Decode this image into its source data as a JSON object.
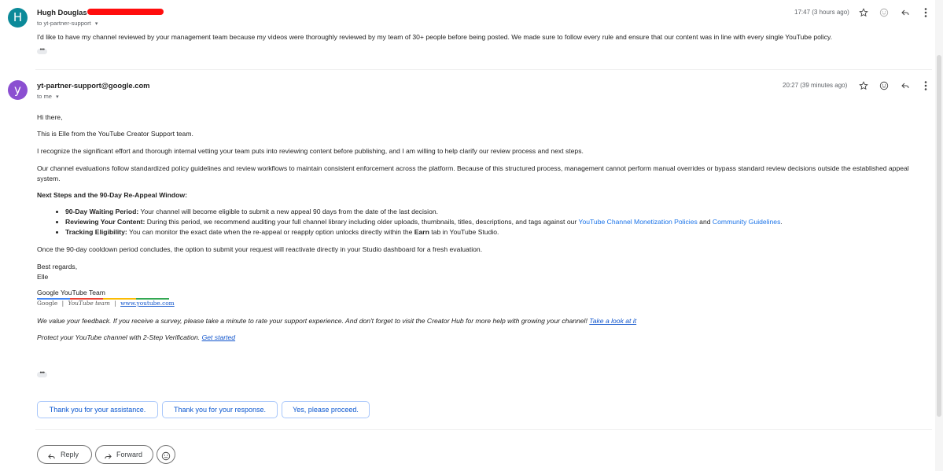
{
  "message1": {
    "avatar_letter": "H",
    "avatar_color": "#0b8a99",
    "sender_name": "Hugh Douglas",
    "recipient": "to yt-partner-support",
    "time": "17:47 (3 hours ago)",
    "body": "I'd like to have my channel reviewed by your management team because my videos were thoroughly reviewed by my team of 30+ people before being posted. We made sure to follow every rule and ensure that our content was in line with every single YouTube policy.",
    "more_label": "•••"
  },
  "message2": {
    "avatar_letter": "y",
    "avatar_color": "#8b4fd1",
    "sender_email": "yt-partner-support@google.com",
    "recipient": "to me",
    "time": "20:27 (39 minutes ago)",
    "greeting": "Hi there,",
    "intro": "This is Elle from the YouTube Creator Support team.",
    "para1": "I recognize the significant effort and thorough internal vetting your team puts into reviewing content before publishing, and I am willing to help clarify our review process and next steps.",
    "para2": "Our channel evaluations follow standardized policy guidelines and review workflows to maintain consistent enforcement across the platform. Because of this structured process, management cannot perform manual overrides or bypass standard review decisions outside the established appeal system.",
    "next_steps_heading": "Next Steps and the 90-Day Re-Appeal Window:",
    "steps": {
      "s1_bold": "90-Day Waiting Period:",
      "s1_text": " Your channel will become eligible to submit a new appeal 90 days from the date of the last decision.",
      "s2_bold": "Reviewing Your Content:",
      "s2_text": " During this period, we recommend auditing your full channel library including older uploads, thumbnails, titles, descriptions, and tags against our ",
      "s2_link1": "YouTube Channel Monetization Policies",
      "s2_and": " and ",
      "s2_link2": "Community Guidelines",
      "s2_end": ".",
      "s3_bold": "Tracking Eligibility:",
      "s3_text": " You can monitor the exact date when the re-appeal or reapply option unlocks directly within the ",
      "s3_bold2": "Earn",
      "s3_end": " tab in YouTube Studio."
    },
    "para3": "Once the 90-day cooldown period concludes, the option to submit your request will reactivate directly in your Studio dashboard for a fresh evaluation.",
    "closing": "Best regards,",
    "signoff": "Elle",
    "signature": {
      "name": "Google YouTube Team",
      "org1": "Google",
      "sep": "|",
      "org2": "YouTube team",
      "url": "www.youtube.com"
    },
    "feedback_text": "We value your feedback. If you receive a survey, please take a minute to rate your support experience. And don't forget to visit the Creator Hub for more help with growing your channel! ",
    "feedback_link": "Take a look at it",
    "protect_text": "Protect your YouTube channel with 2-Step Verification. ",
    "protect_link": "Get started",
    "more_label": "•••"
  },
  "smart_replies": [
    "Thank you for your assistance.",
    "Thank you for your response.",
    "Yes, please proceed."
  ],
  "actions": {
    "reply": "Reply",
    "forward": "Forward"
  }
}
